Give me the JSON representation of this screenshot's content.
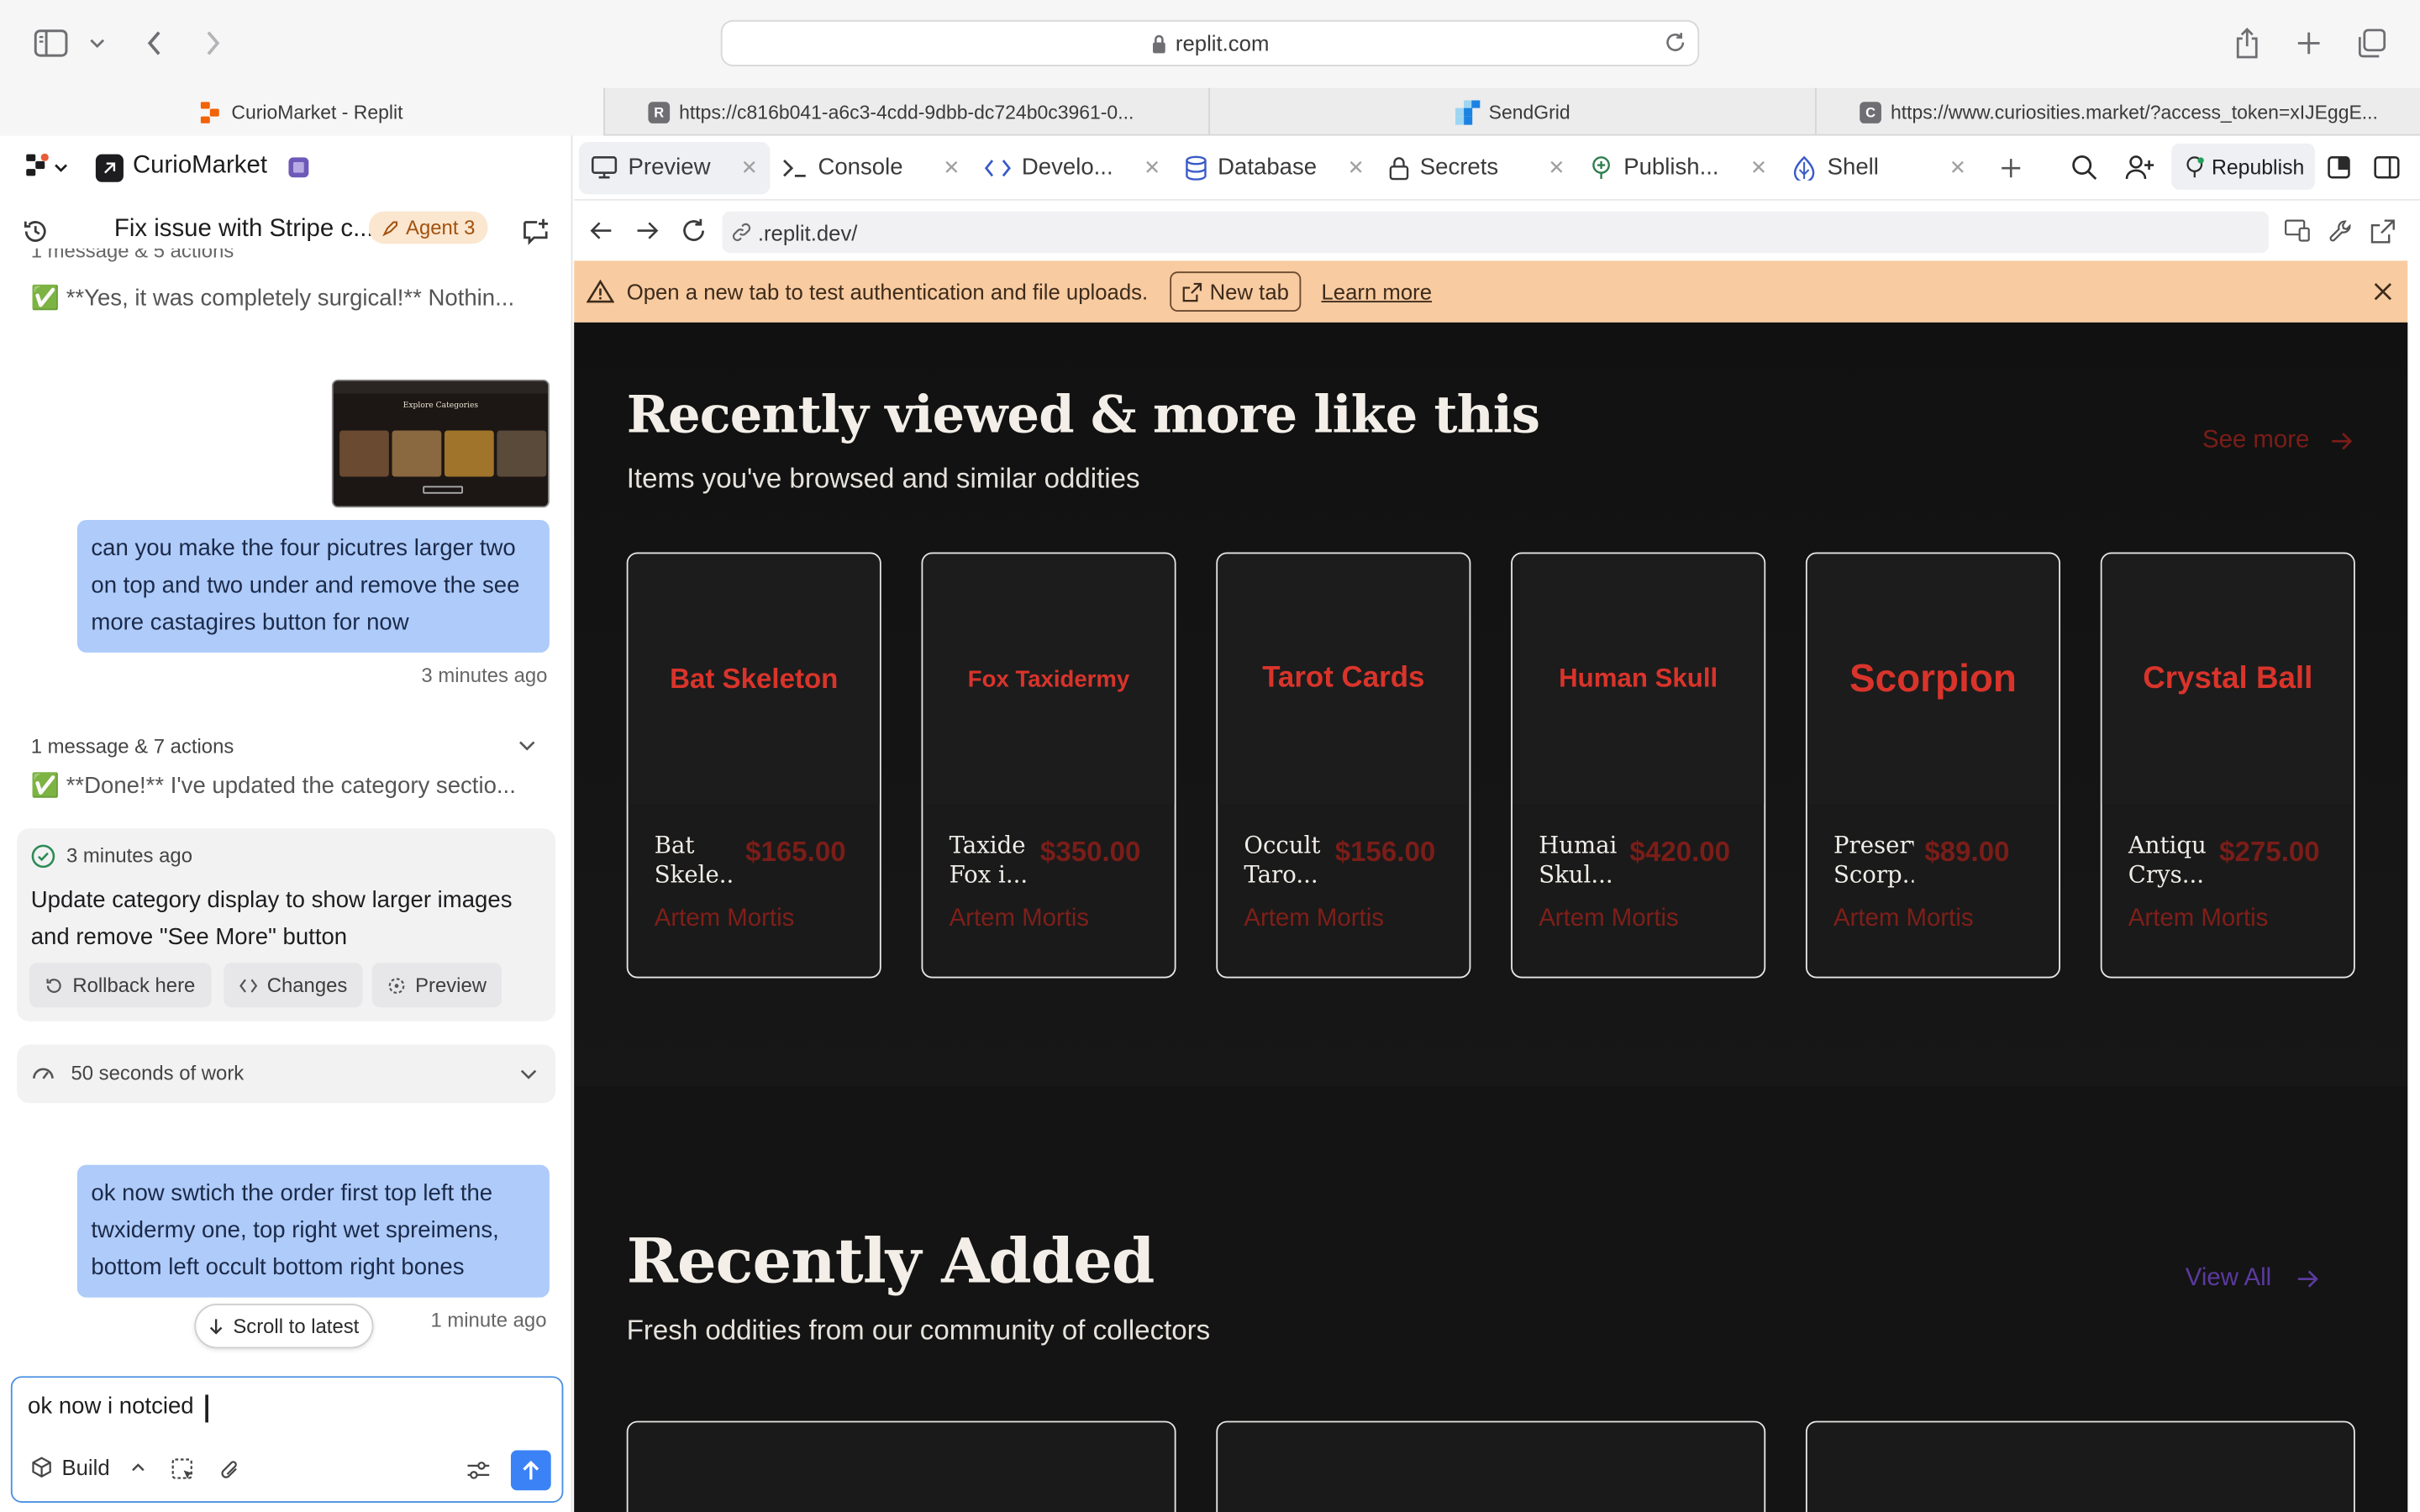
{
  "browser": {
    "address": "replit.com",
    "tabs": [
      {
        "title": "CurioMarket - Replit",
        "fav": "replit",
        "active": true
      },
      {
        "title": "https://c816b041-a6c3-4cdd-9dbb-dc724b0c3961-0...",
        "fav": "R"
      },
      {
        "title": "SendGrid",
        "fav": "sendgrid"
      },
      {
        "title": "https://www.curiosities.market/?access_token=xIJEggE...",
        "fav": "C"
      }
    ]
  },
  "left": {
    "project_name": "CurioMarket",
    "thread_title": "Fix issue with Stripe c...",
    "agent_badge": "Agent 3",
    "prev_summary": "1 message & 5 actions",
    "prev_message": "✅ **Yes, it was completely surgical!** Nothin...",
    "user_msg_1": "can you make the four picutres larger two on top and two under and remove the see more castagires button for now",
    "user_msg_1_time": "3 minutes ago",
    "summary_2": "1 message & 7 actions",
    "message_2": "✅ **Done!** I've updated the category sectio...",
    "checkpoint_time": "3 minutes ago",
    "checkpoint_text": "Update category display to show larger images and remove \"See More\" button",
    "rollback_label": "Rollback here",
    "changes_label": "Changes",
    "preview_label": "Preview",
    "work_label": "50 seconds of work",
    "user_msg_2": "ok now swtich the order first top left the twxidermy one, top right wet spreimens, bottom left occult bottom right bones",
    "user_msg_2_time": "1 minute ago",
    "scroll_label": "Scroll to latest",
    "composer_value": "ok now i notcied ",
    "build_label": "Build",
    "thumb_title": "Explore Categories"
  },
  "workspace": {
    "tabs": [
      {
        "label": "Preview",
        "icon": "monitor-icon"
      },
      {
        "label": "Console",
        "icon": "terminal-icon"
      },
      {
        "label": "Develo...",
        "icon": "code-icon"
      },
      {
        "label": "Database",
        "icon": "database-icon"
      },
      {
        "label": "Secrets",
        "icon": "lock-icon"
      },
      {
        "label": "Publish...",
        "icon": "publish-icon"
      },
      {
        "label": "Shell",
        "icon": "shell-icon"
      }
    ],
    "republish_label": "Republish",
    "url": ".replit.dev/",
    "banner_text": "Open a new tab to test authentication and file uploads.",
    "banner_button": "New tab",
    "banner_link": "Learn more"
  },
  "site": {
    "section1_title": "Recently viewed & more like this",
    "section1_sub": "Items you've browsed and similar oddities",
    "section1_link": "See more",
    "cards": [
      {
        "image_label": "Bat Skeleton",
        "name": "Bat Skele...",
        "price": "$165.00",
        "seller": "Artem Mortis",
        "size": "18"
      },
      {
        "image_label": "Fox Taxidermy",
        "name": "Taxide Fox i...",
        "price": "$350.00",
        "seller": "Artem Mortis",
        "size": "15"
      },
      {
        "image_label": "Tarot Cards",
        "name": "Occult Taro...",
        "price": "$156.00",
        "seller": "Artem Mortis",
        "size": "19"
      },
      {
        "image_label": "Human Skull",
        "name": "Humai Skul...",
        "price": "$420.00",
        "seller": "Artem Mortis",
        "size": "17"
      },
      {
        "image_label": "Scorpion",
        "name": "Preserv Scorp...",
        "price": "$89.00",
        "seller": "Artem Mortis",
        "size": "25"
      },
      {
        "image_label": "Crystal Ball",
        "name": "Antiqu Crys...",
        "price": "$275.00",
        "seller": "Artem Mortis",
        "size": "20"
      }
    ],
    "section2_title": "Recently Added",
    "section2_sub": "Fresh oddities from our community of collectors",
    "section2_link": "View All"
  },
  "colors": {
    "accent_red": "#d9342b",
    "dark_red": "#7a1d18",
    "bubble_blue": "#aecbfa",
    "banner_orange": "#f8cba1",
    "view_all_purple": "#5b3a9e"
  }
}
